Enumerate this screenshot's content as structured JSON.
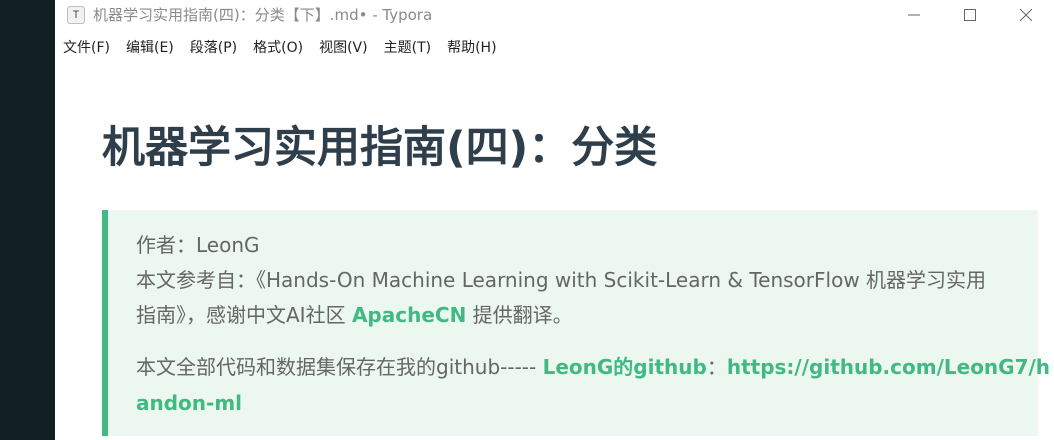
{
  "window": {
    "app_icon_letter": "T",
    "title": "机器学习实用指南(四)：分类【下】.md• - Typora"
  },
  "menu": {
    "items": [
      {
        "label": "文件(F)"
      },
      {
        "label": "编辑(E)"
      },
      {
        "label": "段落(P)"
      },
      {
        "label": "格式(O)"
      },
      {
        "label": "视图(V)"
      },
      {
        "label": "主题(T)"
      },
      {
        "label": "帮助(H)"
      }
    ]
  },
  "document": {
    "heading": "机器学习实用指南(四)：分类",
    "blockquote": {
      "author_line": "作者：LeonG",
      "ref_prefix": "本文参考自：《Hands-On Machine Learning with Scikit-Learn & TensorFlow 机器学习实用",
      "ref_line2_prefix": "指南》，感谢中文AI社区 ",
      "apachecn_link": "ApacheCN",
      "ref_line2_suffix": " 提供翻译。",
      "code_prefix": "本文全部代码和数据集保存在我的github----- ",
      "github_link_label": "LeonG的github",
      "colon": "：",
      "github_url_part1": "https://github.com/LeonG7/h",
      "github_url_part2": "andon-ml"
    }
  },
  "colors": {
    "accent": "#42b983",
    "quote_bg": "#ebf7ef",
    "heading": "#2f3e4b"
  }
}
